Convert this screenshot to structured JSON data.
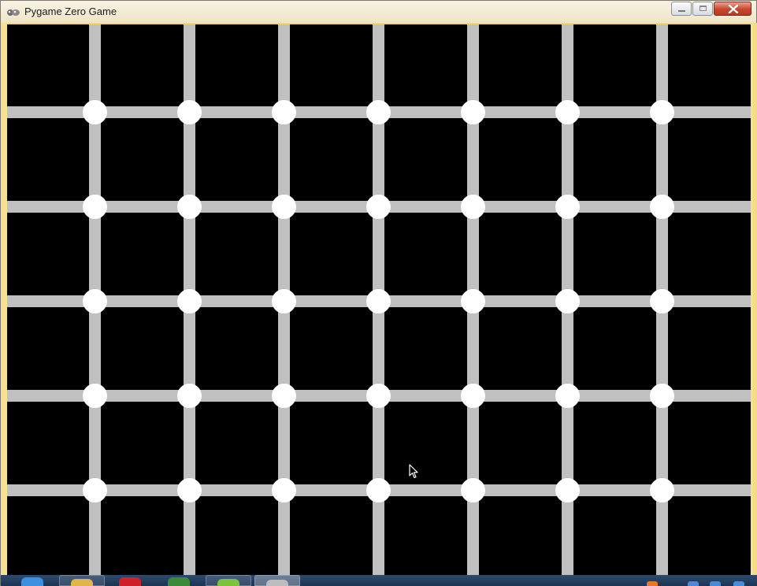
{
  "window": {
    "title": "Pygame Zero Game",
    "app_icon": "pygame-snake-icon",
    "controls": [
      "minimize-icon",
      "maximize-icon",
      "close-icon"
    ]
  },
  "game": {
    "background_color": "#000000",
    "grid_line_color": "#c0c0c0",
    "dot_color": "#ffffff",
    "grid_rows": 5,
    "grid_columns": 7,
    "dots_per_intersection": 35
  },
  "taskbar": {
    "apps": [
      "qq-icon",
      "file-explorer-icon",
      "adobe-icon",
      "media-player-icon",
      "green-app-icon",
      "pygame-window-icon"
    ]
  },
  "colors": {
    "title_bar": "#efe6c8",
    "frame_accent": "#f6d76a",
    "close_button": "#c8452c",
    "taskbar": "#1d3452"
  }
}
